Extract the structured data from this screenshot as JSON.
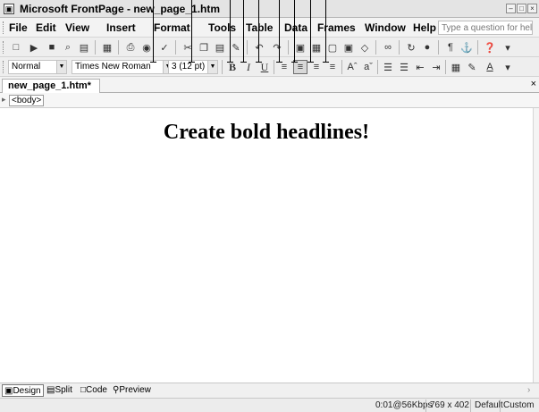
{
  "window": {
    "title": "Microsoft FrontPage - new_page_1.htm"
  },
  "menu": {
    "items": [
      "File",
      "Edit",
      "View",
      "Insert",
      "Format",
      "Tools",
      "Table",
      "Data",
      "Frames",
      "Window",
      "Help"
    ],
    "help_placeholder": "Type a question for help"
  },
  "format": {
    "style": "Normal",
    "font": "Times New Roman",
    "size": "3 (12 pt)",
    "bold": "B",
    "italic": "I",
    "underline": "U"
  },
  "doc": {
    "tab_label": "new_page_1.htm*",
    "tag": "<body>",
    "headline": "Create bold headlines!"
  },
  "views": {
    "design": "Design",
    "split": "Split",
    "code": "Code",
    "preview": "Preview"
  },
  "status": {
    "speed": "0:01@56Kbps",
    "size": "769 x 402",
    "mode": "Default",
    "custom": "Custom"
  },
  "colors": {
    "chrome": "#eeeeee",
    "text": "#000000",
    "active_button": "#d8d8d8"
  }
}
